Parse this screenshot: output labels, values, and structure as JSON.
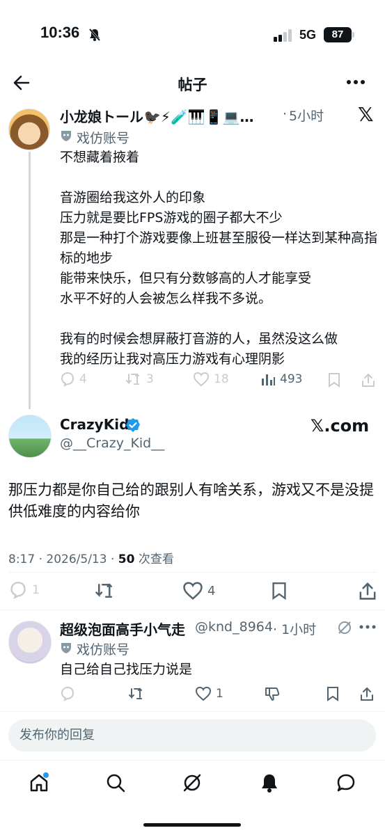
{
  "status_bar": {
    "time": "10:36",
    "network": "5G",
    "battery": "87"
  },
  "header": {
    "title": "帖子"
  },
  "parent_post": {
    "display_name": "小龙娘トール🐦‍⬛⚡🧪🎹📱💻…",
    "time": "5小时",
    "parody_label": "戏仿账号",
    "text": "不想藏着掖着\n\n音游圈给我这外人的印象\n压力就是要比FPS游戏的圈子都大不少\n那是一种打个游戏要像上班甚至服役一样达到某种高指标的地步\n能带来快乐，但只有分数够高的人才能享受\n水平不好的人会被怎么样我不多说。\n\n我有的时候会想屏蔽打音游的人，虽然没这么做\n我的经历让我对高压力游戏有心理阴影",
    "replies": "4",
    "reposts": "3",
    "likes": "18",
    "views": "493"
  },
  "main_post": {
    "display_name": "CrazyKid",
    "handle": "@__Crazy_Kid__",
    "source_badge": "𝕏.com",
    "text": "那压力都是你自己给的跟别人有啥关系，游戏又不是没提供低难度的内容给你",
    "time": "8:17 · 2026/5/13 · ",
    "views": "50",
    "views_label": " 次查看",
    "replies": "1",
    "likes": "4"
  },
  "reply_post": {
    "display_name": "超级泡面高手小气走",
    "handle": "@knd_8964",
    "time": "· 1小时",
    "parody_label": "戏仿账号",
    "text": "自己给自己找压力说是",
    "likes": "1"
  },
  "composer": {
    "placeholder": "发布你的回复"
  },
  "colors": {
    "accent": "#1d9bf0",
    "text": "#0f1419",
    "muted": "#536471",
    "faded": "#c7ccd1"
  }
}
